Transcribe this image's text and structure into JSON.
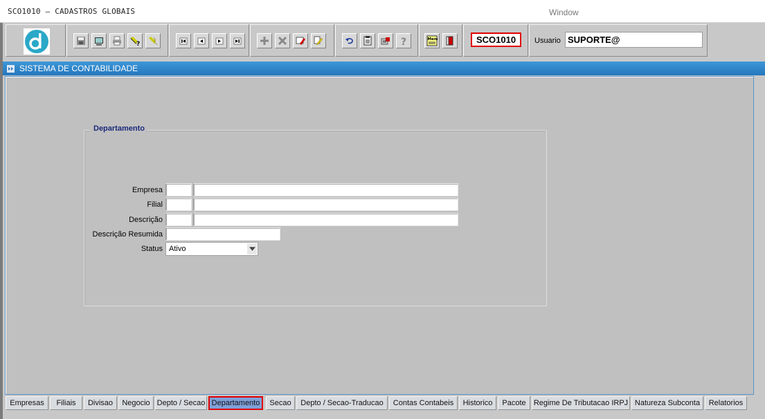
{
  "window": {
    "title": "SCO1010 – CADASTROS GLOBAIS",
    "window_menu": "Window"
  },
  "toolbar": {
    "form_code": "SCO1010",
    "user_label": "Usuario",
    "user_value": "SUPORTE@",
    "buttons": [
      "save-icon",
      "screen-icon",
      "print-icon",
      "query-icon",
      "execute-query-icon",
      "first-record-icon",
      "previous-record-icon",
      "next-record-icon",
      "last-record-icon",
      "insert-record-icon",
      "delete-record-icon",
      "edit-icon",
      "clear-icon",
      "undo-icon",
      "list-icon",
      "help-icon",
      "question-icon",
      "menu-icon",
      "exit-icon"
    ]
  },
  "app": {
    "title": "SISTEMA DE CONTABILIDADE"
  },
  "form": {
    "section_title": "Departamento",
    "fields": {
      "empresa_label": "Empresa",
      "filial_label": "Filial",
      "descricao_label": "Descrição",
      "descricao_resumida_label": "Descrição Resumida",
      "status_label": "Status",
      "status_value": "Ativo"
    }
  },
  "tabs": [
    {
      "label": "Empresas",
      "active": false
    },
    {
      "label": "Filiais",
      "active": false
    },
    {
      "label": "Divisao",
      "active": false
    },
    {
      "label": "Negocio",
      "active": false
    },
    {
      "label": "Depto / Secao",
      "active": false
    },
    {
      "label": "Departamento",
      "active": true
    },
    {
      "label": "Secao",
      "active": false
    },
    {
      "label": "Depto / Secao-Traducao",
      "active": false
    },
    {
      "label": "Contas Contabeis",
      "active": false
    },
    {
      "label": "Historico",
      "active": false
    },
    {
      "label": "Pacote",
      "active": false
    },
    {
      "label": "Regime De Tributacao IRPJ",
      "active": false
    },
    {
      "label": "Natureza Subconta",
      "active": false
    },
    {
      "label": "Relatorios",
      "active": false
    }
  ],
  "colors": {
    "accent_blue": "#2d82c7",
    "highlight_red": "#e00000",
    "active_tab": "#7fa0d8"
  }
}
